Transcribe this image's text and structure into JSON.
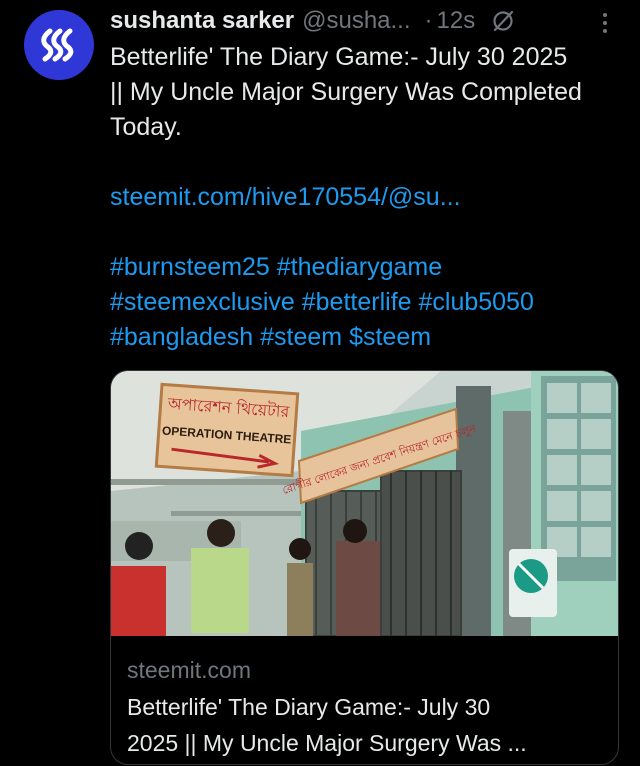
{
  "post": {
    "author_name": "sushanta sarker",
    "handle": "@susha...",
    "separator": "·",
    "time": "12s",
    "text_lines": [
      "Betterlife' The Diary Game:- July 30 2025",
      "|| My Uncle Major Surgery Was Completed",
      "Today."
    ],
    "link": "steemit.com/hive170554/@su...",
    "hashtag_lines": [
      "#burnsteem25 #thediarygame",
      "#steemexclusive #betterlife #club5050",
      "#bangladesh #steem $steem"
    ]
  },
  "card": {
    "sign_bengali": "অপারেশন থিয়েটার",
    "sign_english": "OPERATION THEATRE",
    "banner_bengali": "রোগীর লোকের জন্য প্রবেশ নিয়ন্ত্রণ মেনে চলুন",
    "domain": "steemit.com",
    "title_lines": [
      "Betterlife' The Diary Game:- July 30",
      "2025 || My Uncle Major Surgery Was ..."
    ]
  },
  "icons": {
    "avatar": "steem-logo-icon",
    "grok": "grok-icon",
    "more": "more-options-icon"
  },
  "colors": {
    "background": "#000000",
    "text": "#e7e9ea",
    "muted": "#71767b",
    "link": "#1d9bf0",
    "avatar_bg": "#2f37d6"
  }
}
